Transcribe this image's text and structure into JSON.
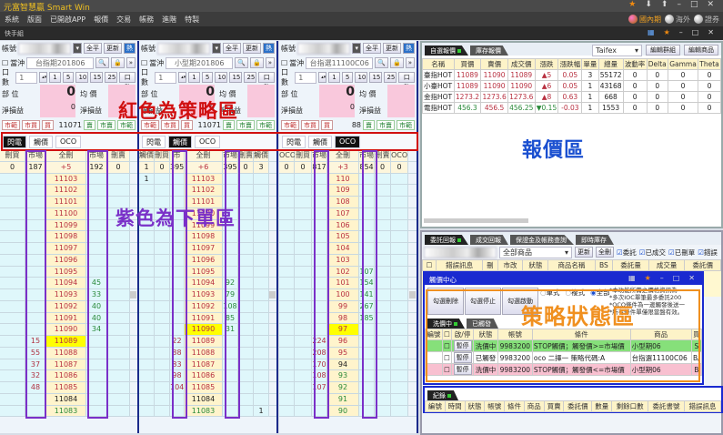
{
  "app": {
    "title": "元富智慧贏 Smart Win",
    "menu": [
      "系統",
      "版面",
      "已開啟APP",
      "報價",
      "交易",
      "帳務",
      "進階",
      "特製"
    ],
    "group_title": "快手組",
    "markets": [
      "國內期",
      "海外",
      "證券"
    ]
  },
  "colors": {
    "bid": "#b03040",
    "ask": "#2a8a3a",
    "highlight": "#ffff00",
    "strategy_box": "#d01010",
    "order_box": "#7a30c8",
    "status_box": "#f09020",
    "quote_label": "#1a4fd0"
  },
  "annotations": {
    "strategy": "紅色為策略區",
    "order": "紫色為下單區",
    "quote": "報價區",
    "status": "策略狀態區"
  },
  "panels": [
    {
      "account_label": "帳號",
      "close_all": "全平",
      "refresh": "更新",
      "hot": "熱",
      "daytrade": "當沖",
      "daytrade_checked": false,
      "product": "台指期201806",
      "qty_label": "口數",
      "qty": "1",
      "qty_presets": [
        "1",
        "5",
        "10",
        "15",
        "25"
      ],
      "qty_right": "口數",
      "position_label": "部 位",
      "position": "0",
      "avg_label": "均 價",
      "pnl_label": "淨損益",
      "pnl": "0",
      "pnl_label2": "淨損益",
      "order_buttons": [
        "市範",
        "市買",
        "買"
      ],
      "last": "11071",
      "sell_buttons": [
        "賣",
        "市賣",
        "市範"
      ],
      "tabs": [
        "閃電",
        "觸價",
        "OCO"
      ],
      "active_tab": 0,
      "columns": [
        "刪買",
        "市場",
        "全刪",
        "市場",
        "刪賣"
      ],
      "summary": [
        "0",
        "187",
        "+5",
        "192",
        "0"
      ],
      "rows": [
        [
          "",
          "",
          "11103",
          "",
          "",
          "up"
        ],
        [
          "",
          "",
          "11102",
          "",
          "",
          "up"
        ],
        [
          "",
          "",
          "11101",
          "",
          "",
          "up"
        ],
        [
          "",
          "",
          "11100",
          "",
          "",
          "up"
        ],
        [
          "",
          "",
          "11099",
          "",
          "",
          "up"
        ],
        [
          "",
          "",
          "11098",
          "",
          "",
          "up"
        ],
        [
          "",
          "",
          "11097",
          "",
          "",
          "up"
        ],
        [
          "",
          "",
          "11096",
          "",
          "",
          "up"
        ],
        [
          "",
          "",
          "11095",
          "",
          "",
          "up"
        ],
        [
          "",
          "",
          "11094",
          "45",
          "",
          "up"
        ],
        [
          "",
          "",
          "11093",
          "33",
          "",
          "up"
        ],
        [
          "",
          "",
          "11092",
          "40",
          "",
          "up"
        ],
        [
          "",
          "",
          "11091",
          "40",
          "",
          "up"
        ],
        [
          "",
          "",
          "11090",
          "34",
          "",
          "up"
        ],
        [
          "",
          "15",
          "11089",
          "",
          "",
          "up",
          "hl"
        ],
        [
          "",
          "55",
          "11088",
          "",
          "",
          "up"
        ],
        [
          "",
          "37",
          "11087",
          "",
          "",
          "up"
        ],
        [
          "",
          "32",
          "11086",
          "",
          "",
          "up"
        ],
        [
          "",
          "48",
          "11085",
          "",
          "",
          "up"
        ],
        [
          "",
          "",
          "11084",
          "",
          "",
          "fl"
        ],
        [
          "",
          "",
          "11083",
          "",
          "",
          "dn"
        ]
      ]
    },
    {
      "account_label": "帳號",
      "close_all": "全平",
      "refresh": "更新",
      "hot": "熱",
      "daytrade": "當沖",
      "daytrade_checked": false,
      "product": "小型期201806",
      "qty_label": "口數",
      "qty": "1",
      "qty_presets": [
        "1",
        "5",
        "10",
        "15",
        "25"
      ],
      "qty_right": "口數",
      "position_label": "部 位",
      "position": "0",
      "avg_label": "均 價",
      "pnl_label": "淨損益",
      "pnl": "0",
      "pnl_label2": "淨損益",
      "order_buttons": [
        "市範",
        "市買",
        "買"
      ],
      "last": "11071",
      "sell_buttons": [
        "賣",
        "市賣",
        "市範"
      ],
      "tabs": [
        "閃電",
        "觸價",
        "OCO"
      ],
      "active_tab": 1,
      "columns": [
        "觸價",
        "刪買",
        "市場",
        "全刪",
        "市場",
        "刪賣",
        "觸價"
      ],
      "summary": [
        "1",
        "0",
        "395",
        "+6",
        "395",
        "0",
        "3"
      ],
      "rows": [
        [
          "1",
          "",
          "",
          "11103",
          "",
          "",
          "",
          "up"
        ],
        [
          "",
          "",
          "",
          "11102",
          "",
          "",
          "",
          "up"
        ],
        [
          "",
          "",
          "",
          "11101",
          "",
          "",
          "",
          "up"
        ],
        [
          "",
          "",
          "",
          "11100",
          "",
          "",
          "",
          "up"
        ],
        [
          "",
          "",
          "",
          "11099",
          "",
          "",
          "",
          "up"
        ],
        [
          "",
          "",
          "",
          "11098",
          "",
          "",
          "",
          "up"
        ],
        [
          "",
          "",
          "",
          "11097",
          "",
          "",
          "",
          "up"
        ],
        [
          "",
          "",
          "",
          "11096",
          "",
          "",
          "",
          "up"
        ],
        [
          "",
          "",
          "",
          "11095",
          "",
          "",
          "",
          "up"
        ],
        [
          "",
          "",
          "",
          "11094",
          "92",
          "",
          "",
          "up"
        ],
        [
          "",
          "",
          "",
          "11093",
          "79",
          "",
          "",
          "up"
        ],
        [
          "",
          "",
          "",
          "11092",
          "108",
          "",
          "",
          "up"
        ],
        [
          "",
          "",
          "",
          "11091",
          "85",
          "",
          "",
          "up"
        ],
        [
          "",
          "",
          "",
          "11090",
          "31",
          "",
          "",
          "up",
          "hl"
        ],
        [
          "",
          "",
          "22",
          "11089",
          "",
          "",
          "",
          "up"
        ],
        [
          "",
          "",
          "88",
          "11088",
          "",
          "",
          "",
          "up"
        ],
        [
          "",
          "",
          "83",
          "11087",
          "",
          "",
          "",
          "up"
        ],
        [
          "",
          "",
          "98",
          "11086",
          "",
          "",
          "",
          "up"
        ],
        [
          "",
          "",
          "104",
          "11085",
          "",
          "",
          "",
          "up"
        ],
        [
          "",
          "",
          "",
          "11084",
          "",
          "",
          "",
          "fl"
        ],
        [
          "",
          "",
          "",
          "11083",
          "",
          "",
          "1",
          "dn"
        ]
      ]
    },
    {
      "account_label": "帳號",
      "close_all": "全平",
      "refresh": "更新",
      "hot": "熱",
      "daytrade": "當沖",
      "daytrade_checked": false,
      "product": "台指選11100C06",
      "qty_label": "口數",
      "qty": "1",
      "qty_presets": [
        "1",
        "5",
        "10",
        "15",
        "25"
      ],
      "qty_right": "口數",
      "position_label": "部 位",
      "position": "0",
      "avg_label": "均 價",
      "pnl_label": "淨損益",
      "pnl": "0",
      "pnl_label2": "淨損益",
      "order_buttons": [
        "市範",
        "市買",
        "買"
      ],
      "last": "88",
      "sell_buttons": [
        "賣",
        "市賣",
        "市範"
      ],
      "tabs": [
        "閃電",
        "觸價",
        "OCO"
      ],
      "active_tab": 2,
      "columns": [
        "OCO",
        "刪買",
        "市場",
        "全刪",
        "市場",
        "刪賣",
        "OCO"
      ],
      "summary": [
        "0",
        "0",
        "817",
        "+3",
        "854",
        "0",
        "0"
      ],
      "rows": [
        [
          "",
          "",
          "",
          "110",
          "",
          "",
          "",
          "up"
        ],
        [
          "",
          "",
          "",
          "109",
          "",
          "",
          "",
          "up"
        ],
        [
          "",
          "",
          "",
          "108",
          "",
          "",
          "",
          "up"
        ],
        [
          "",
          "",
          "",
          "107",
          "",
          "",
          "",
          "up"
        ],
        [
          "",
          "",
          "",
          "106",
          "",
          "",
          "",
          "up"
        ],
        [
          "",
          "",
          "",
          "105",
          "",
          "",
          "",
          "up"
        ],
        [
          "",
          "",
          "",
          "104",
          "",
          "",
          "",
          "up"
        ],
        [
          "",
          "",
          "",
          "103",
          "",
          "",
          "",
          "up"
        ],
        [
          "",
          "",
          "",
          "102",
          "107",
          "",
          "",
          "up"
        ],
        [
          "",
          "",
          "",
          "101",
          "154",
          "",
          "",
          "up"
        ],
        [
          "",
          "",
          "",
          "100",
          "141",
          "",
          "",
          "up"
        ],
        [
          "",
          "",
          "",
          "99",
          "267",
          "",
          "",
          "up"
        ],
        [
          "",
          "",
          "",
          "98",
          "185",
          "",
          "",
          "up"
        ],
        [
          "",
          "",
          "",
          "97",
          "",
          "",
          "",
          "up",
          "hl"
        ],
        [
          "",
          "",
          "224",
          "96",
          "",
          "",
          "",
          "up"
        ],
        [
          "",
          "",
          "208",
          "95",
          "",
          "",
          "",
          "up"
        ],
        [
          "",
          "",
          "170",
          "94",
          "",
          "",
          "",
          "fl"
        ],
        [
          "",
          "",
          "108",
          "93",
          "",
          "",
          "",
          "dn"
        ],
        [
          "",
          "",
          "107",
          "92",
          "",
          "",
          "",
          "dn"
        ],
        [
          "",
          "",
          "",
          "91",
          "",
          "",
          "",
          "dn"
        ],
        [
          "",
          "",
          "",
          "90",
          "",
          "",
          "",
          "dn"
        ]
      ]
    }
  ],
  "quote": {
    "tabs": [
      "自選報價",
      "庫存報價"
    ],
    "exchange": "Taifex",
    "edit_group": "編輯群組",
    "edit_product": "編輯商品",
    "columns": [
      "名稱",
      "買價",
      "賣價",
      "成交價",
      "漲跌",
      "漲跌幅",
      "單量",
      "總量",
      "波動率",
      "Delta",
      "Gamma",
      "Theta"
    ],
    "rows": [
      {
        "cells": [
          "臺指HOT",
          "11089",
          "11090",
          "11089",
          "▲5",
          "0.05",
          "3",
          "55172",
          "0",
          "0",
          "0",
          "0"
        ],
        "dir": "up"
      },
      {
        "cells": [
          "小臺HOT",
          "11089",
          "11090",
          "11090",
          "▲6",
          "0.05",
          "1",
          "43168",
          "0",
          "0",
          "0",
          "0"
        ],
        "dir": "up"
      },
      {
        "cells": [
          "金指HOT",
          "1273.2",
          "1273.6",
          "1273.6",
          "▲8",
          "0.63",
          "1",
          "668",
          "0",
          "0",
          "0",
          "0"
        ],
        "dir": "up"
      },
      {
        "cells": [
          "電指HOT",
          "456.3",
          "456.5",
          "456.25",
          "▼0.15",
          "-0.03",
          "1",
          "1553",
          "0",
          "0",
          "0",
          "0"
        ],
        "dir": "dn"
      }
    ]
  },
  "orders": {
    "tabs": [
      "委託回報",
      "成交回報",
      "保證金及帳務查詢",
      "即時庫存"
    ],
    "product_filter": "全部商品",
    "refresh": "更新",
    "delete_all": "全刪",
    "checks": [
      "委託",
      "已成交",
      "已刪單",
      "錯誤"
    ],
    "columns": [
      "錯誤訊息",
      "刪",
      "市改",
      "狀態",
      "商品名稱",
      "BS",
      "委託量",
      "成交量",
      "委託價"
    ]
  },
  "trigger_center": {
    "title": "觸價中心",
    "buttons": [
      "勾選刪除",
      "勾選停止",
      "勾選啟動"
    ],
    "modes": [
      "單式",
      "複式",
      "全部"
    ],
    "mode_selected": 2,
    "notes": [
      "*本功能所需之價格資訊為",
      "*多次IOC單筆最多委託200",
      "*OCO條件為一邊觸發後送一",
      "*所有條件單僅限當盤有效。"
    ],
    "tabs": [
      "洗價中",
      "已觸發"
    ],
    "columns": [
      "編號",
      "",
      "啟/停",
      "狀態",
      "帳號",
      "條件",
      "商品",
      "買"
    ],
    "rows": [
      {
        "btn": "暫停",
        "status": "洗價中",
        "account": "9983200",
        "cond": "STOP觸價；觸發價>=市場價",
        "product": "小型期06",
        "bs": "S",
        "bg": "#86e07a"
      },
      {
        "btn": "暫停",
        "status": "已觸發",
        "account": "9983200",
        "cond": "oco 二擇一 策略代碼:A",
        "product": "台指選11100C06",
        "bs": "B/",
        "bg": "#ffffff"
      },
      {
        "btn": "暫停",
        "status": "洗價中",
        "account": "9983200",
        "cond": "STOP觸價；觸發價<=市場價",
        "product": "小型期06",
        "bs": "B",
        "bg": "#f8c0d0"
      }
    ]
  },
  "records": {
    "tab": "紀錄",
    "columns": [
      "編號",
      "時間",
      "狀態",
      "帳號",
      "條件",
      "商品",
      "買賣",
      "委託價",
      "數量",
      "剩餘口數",
      "委託書號",
      "錯誤訊息"
    ]
  }
}
